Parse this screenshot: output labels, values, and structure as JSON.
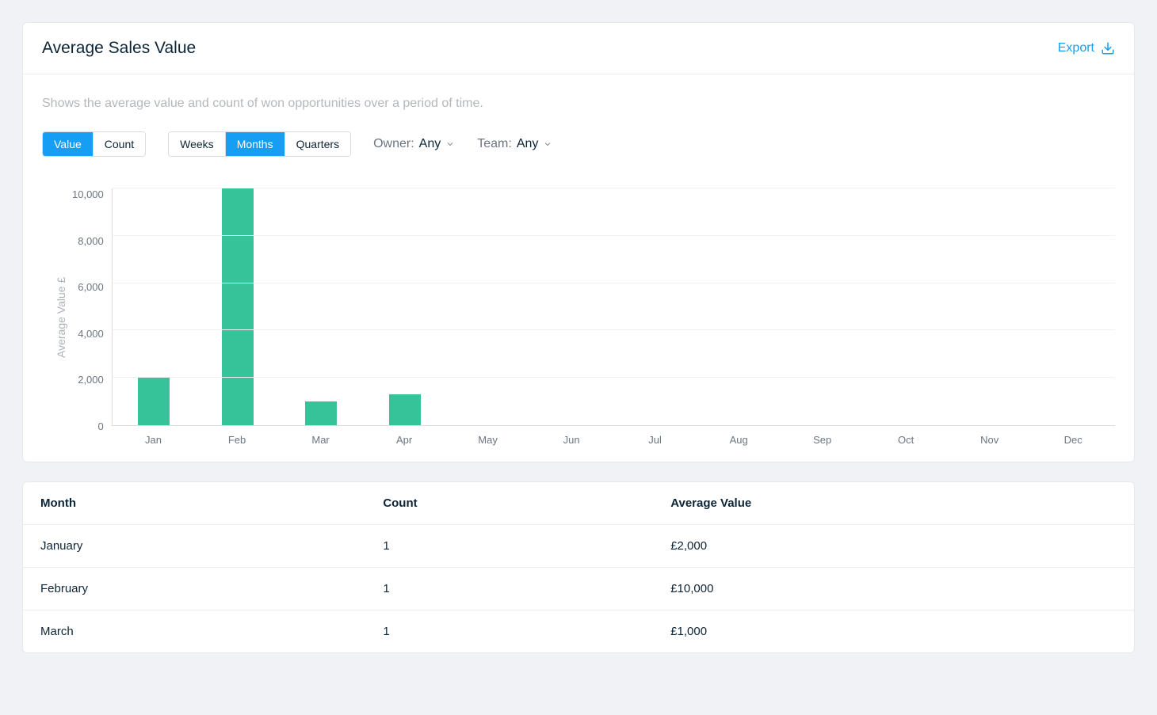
{
  "header": {
    "title": "Average Sales Value",
    "export_label": "Export"
  },
  "subtitle": "Shows the average value and count of won opportunities over a period of time.",
  "controls": {
    "metric": {
      "options": [
        "Value",
        "Count"
      ],
      "active": "Value"
    },
    "period": {
      "options": [
        "Weeks",
        "Months",
        "Quarters"
      ],
      "active": "Months"
    },
    "owner": {
      "label": "Owner:",
      "value": "Any"
    },
    "team": {
      "label": "Team:",
      "value": "Any"
    }
  },
  "chart_data": {
    "type": "bar",
    "categories": [
      "Jan",
      "Feb",
      "Mar",
      "Apr",
      "May",
      "Jun",
      "Jul",
      "Aug",
      "Sep",
      "Oct",
      "Nov",
      "Dec"
    ],
    "values": [
      2000,
      10000,
      1000,
      1300,
      0,
      0,
      0,
      0,
      0,
      0,
      0,
      0
    ],
    "title": "Average Sales Value",
    "xlabel": "",
    "ylabel": "Average Value £",
    "ylim": [
      0,
      10000
    ],
    "yticks": [
      10000,
      8000,
      6000,
      4000,
      2000,
      0
    ],
    "ytick_labels": [
      "10,000",
      "8,000",
      "6,000",
      "4,000",
      "2,000",
      "0"
    ],
    "bar_color": "#36c399"
  },
  "table": {
    "columns": [
      "Month",
      "Count",
      "Average Value"
    ],
    "rows": [
      {
        "month": "January",
        "count": "1",
        "avg": "£2,000"
      },
      {
        "month": "February",
        "count": "1",
        "avg": "£10,000"
      },
      {
        "month": "March",
        "count": "1",
        "avg": "£1,000"
      }
    ]
  }
}
